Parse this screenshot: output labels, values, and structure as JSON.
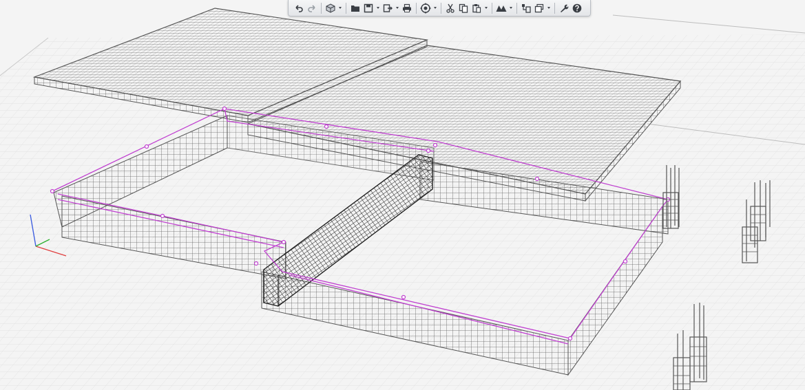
{
  "app": {
    "toolbar": {
      "buttons": [
        {
          "id": "undo",
          "icon": "undo-icon",
          "enabled": true
        },
        {
          "id": "redo",
          "icon": "redo-icon",
          "enabled": false
        },
        {
          "id": "view-3d",
          "icon": "cube-icon",
          "dropdown": true
        },
        {
          "id": "open",
          "icon": "folder-icon"
        },
        {
          "id": "save",
          "icon": "save-icon",
          "dropdown": true
        },
        {
          "id": "export",
          "icon": "export-icon",
          "dropdown": true
        },
        {
          "id": "print",
          "icon": "print-icon"
        },
        {
          "id": "settings-3d",
          "icon": "gear-icon",
          "dropdown": true
        },
        {
          "id": "cut",
          "icon": "scissors-icon"
        },
        {
          "id": "copy",
          "icon": "copy-icon"
        },
        {
          "id": "paste",
          "icon": "paste-icon",
          "dropdown": true
        },
        {
          "id": "render-mode",
          "icon": "mountain-icon",
          "dropdown": true
        },
        {
          "id": "layers",
          "icon": "layers-icon"
        },
        {
          "id": "display",
          "icon": "display-options-icon",
          "dropdown": true
        },
        {
          "id": "tools",
          "icon": "wrench-icon"
        },
        {
          "id": "help",
          "icon": "help-icon"
        }
      ]
    },
    "colors": {
      "background": "#f4f4f4",
      "grid": "#dcdcdc",
      "rebar": "#5a5a5a",
      "selection": "#c040d0",
      "axis_x": "#e04040",
      "axis_y": "#30b030",
      "axis_z": "#4060e0"
    }
  }
}
